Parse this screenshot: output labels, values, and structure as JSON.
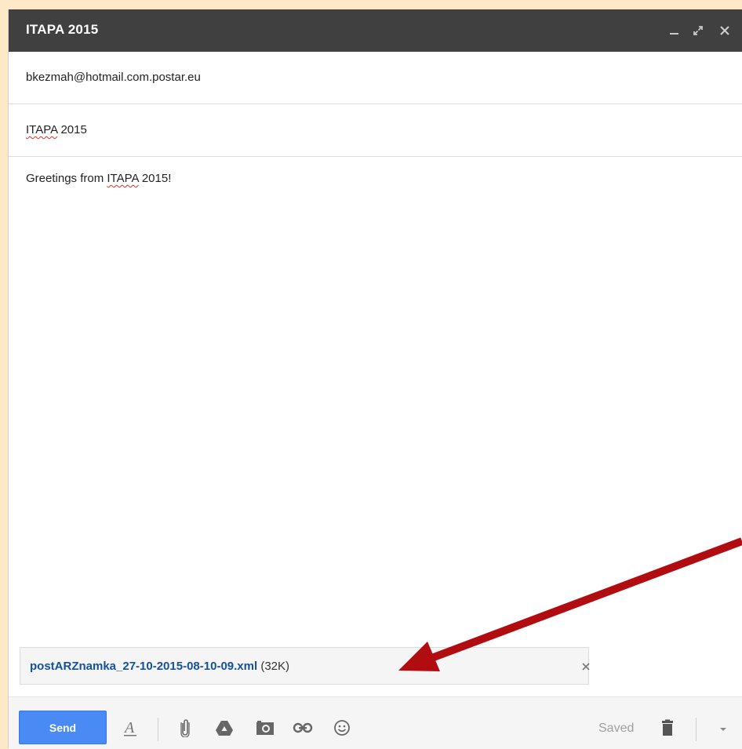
{
  "window": {
    "title": "ITAPA 2015",
    "controls": [
      "minimize-icon",
      "pop-out-icon",
      "close-icon"
    ]
  },
  "compose": {
    "to": "bkezmah@hotmail.com.postar.eu",
    "subject_word": "ITAPA",
    "subject_rest": " 2015",
    "body_before": "Greetings from ",
    "body_word": "ITAPA",
    "body_after": " 2015!"
  },
  "attachment": {
    "name": "postARZnamka_27-10-2015-08-10-09.xml",
    "size": " (32K)"
  },
  "footer": {
    "send_label": "Send",
    "status": "Saved"
  },
  "icons": {
    "formatting": "text-formatting-icon",
    "attach": "paperclip-icon",
    "drive": "google-drive-icon",
    "photo": "camera-icon",
    "link": "link-icon",
    "emoji": "emoji-icon",
    "trash": "trash-icon",
    "more": "chevron-down-icon"
  },
  "colors": {
    "page_background": "#fde9c8",
    "titlebar": "#404040",
    "send_button": "#4a8af4",
    "attachment_link": "#15509c",
    "annotation_arrow": "#b10d10"
  }
}
